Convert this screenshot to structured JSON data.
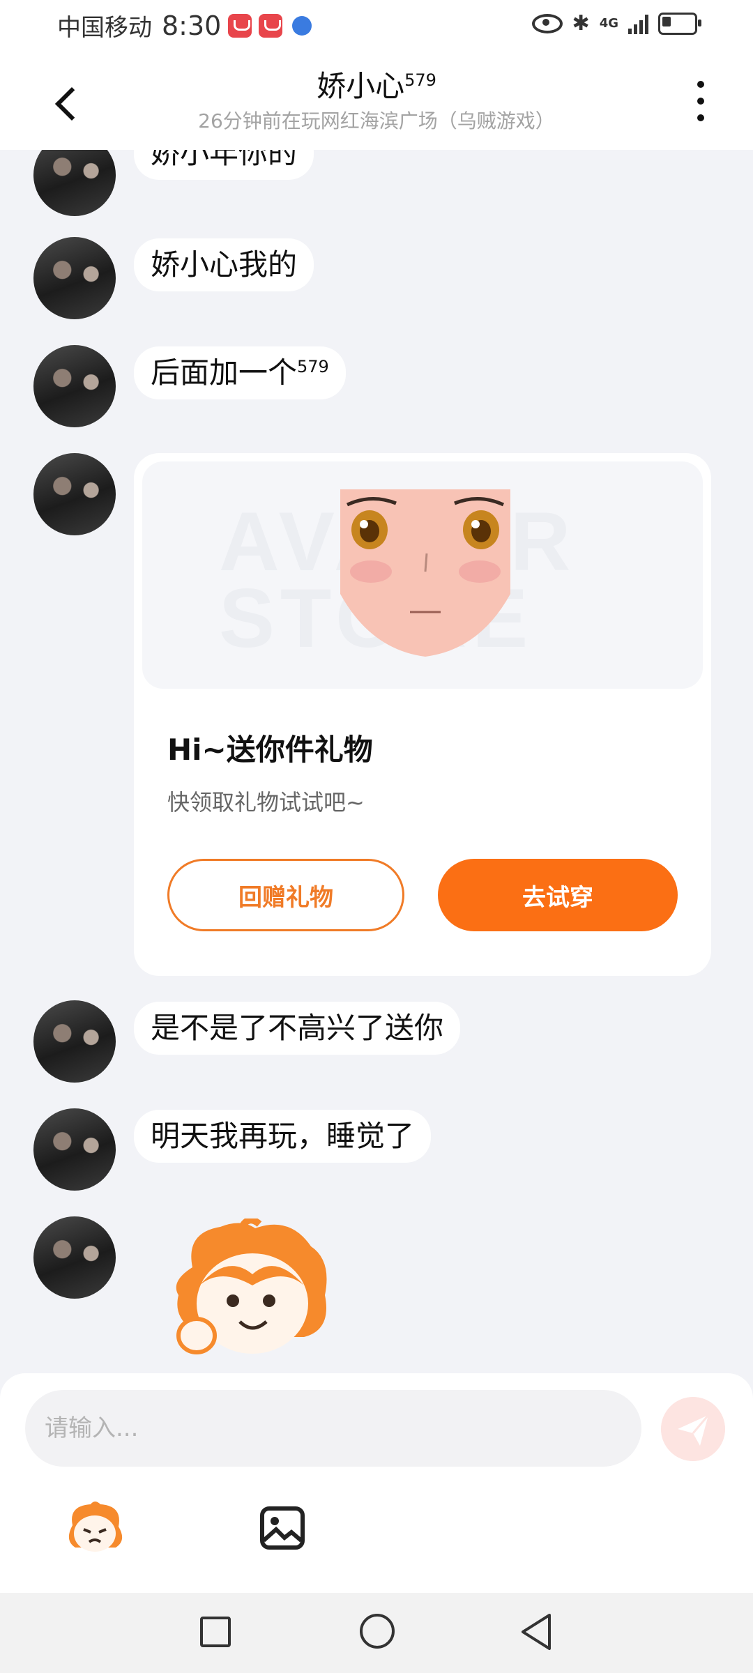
{
  "status_bar": {
    "carrier": "中国移动",
    "time": "8:30",
    "network": "4G"
  },
  "header": {
    "title_name": "娇小心",
    "title_sup": "579",
    "subtitle": "26分钟前在玩网红海滨广场（乌贼游戏）"
  },
  "messages": [
    {
      "text": "娇小年你的"
    },
    {
      "text": "娇小心我的"
    },
    {
      "text": "后面加一个",
      "sup": "579"
    },
    {
      "text": "是不是了不高兴了送你"
    },
    {
      "text": "明天我再玩，睡觉了"
    }
  ],
  "gift_card": {
    "watermark": "AVATAR STORE",
    "title": "Hi~送你件礼物",
    "subtitle": "快领取礼物试试吧~",
    "return_button": "回赠礼物",
    "try_button": "去试穿"
  },
  "input": {
    "placeholder": "请输入..."
  },
  "colors": {
    "accent_orange": "#fb6f14",
    "chat_background": "#f2f3f7"
  },
  "icons": {
    "back": "chevron-left-icon",
    "more": "more-vertical-icon",
    "send": "send-icon",
    "emoji": "emoji-icon",
    "image": "image-icon"
  }
}
